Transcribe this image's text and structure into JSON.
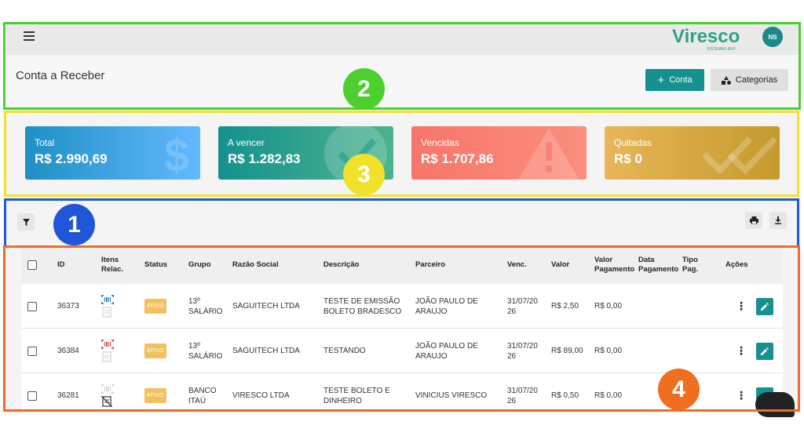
{
  "app": {
    "logo_text": "Viresco",
    "logo_sub": "SISTEMAS ERP",
    "avatar_initials": "NS",
    "brand_color": "#15918f"
  },
  "header": {
    "title": "Conta a Receber",
    "add_button_label": "Conta",
    "categories_button_label": "Categorias"
  },
  "cards": [
    {
      "label": "Total",
      "value": "R$ 2.990,69",
      "icon": "dollar-icon"
    },
    {
      "label": "A vencer",
      "value": "R$ 1.282,83",
      "icon": "check-circle-icon"
    },
    {
      "label": "Vencidas",
      "value": "R$ 1.707,86",
      "icon": "warning-icon"
    },
    {
      "label": "Quitadas",
      "value": "R$ 0",
      "icon": "double-check-icon"
    }
  ],
  "table": {
    "headers": {
      "id": "ID",
      "itens1": "Itens",
      "itens2": "Relac.",
      "status": "Status",
      "grupo": "Grupo",
      "razao": "Razão Social",
      "descricao": "Descrição",
      "parceiro": "Parceiro",
      "venc": "Venc.",
      "valor": "Valor",
      "valorpag1": "Valor",
      "valorpag2": "Pagamento",
      "datapag1": "Data",
      "datapag2": "Pagamento",
      "tipopag1": "Tipo",
      "tipopag2": "Pag.",
      "acoes": "Ações"
    },
    "rows": [
      {
        "id": "36373",
        "status": "ATIVO",
        "grupo1": "13º",
        "grupo2": "SALÁRIO",
        "razao": "SAGUITECH LTDA",
        "desc1": "TESTE DE EMISSÃO",
        "desc2": "BOLETO BRADESCO",
        "parc1": "JOÃO PAULO DE",
        "parc2": "ARAUJO",
        "venc1": "31/07/20",
        "venc2": "26",
        "valor": "R$ 2,50",
        "valor_pag": "R$ 0,00",
        "barcode_color": "#1e7fd0"
      },
      {
        "id": "36384",
        "status": "ATIVO",
        "grupo1": "13º",
        "grupo2": "SALÁRIO",
        "razao": "SAGUITECH LTDA",
        "desc1": "TESTANDO",
        "desc2": "",
        "parc1": "JOÃO PAULO DE",
        "parc2": "ARAUJO",
        "venc1": "31/07/20",
        "venc2": "26",
        "valor": "R$ 89,00",
        "valor_pag": "R$ 0,00",
        "barcode_color": "#e0474c"
      },
      {
        "id": "36281",
        "status": "ATIVO",
        "grupo1": "BANCO",
        "grupo2": "ITAÚ",
        "razao": "VIRESCO LTDA",
        "desc1": "TESTE BOLETO E",
        "desc2": "DINHEIRO",
        "parc1": "VINICIUS VIRESCO",
        "parc2": "",
        "venc1": "31/07/20",
        "venc2": "26",
        "valor": "R$ 0,50",
        "valor_pag": "R$ 0,00",
        "barcode_color": "#cfcfcf"
      }
    ]
  },
  "annotations": [
    {
      "number": "2",
      "color": "#4bd02e"
    },
    {
      "number": "3",
      "color": "#f0e22a"
    },
    {
      "number": "1",
      "color": "#1f55d6"
    },
    {
      "number": "4",
      "color": "#f16d1f"
    }
  ]
}
